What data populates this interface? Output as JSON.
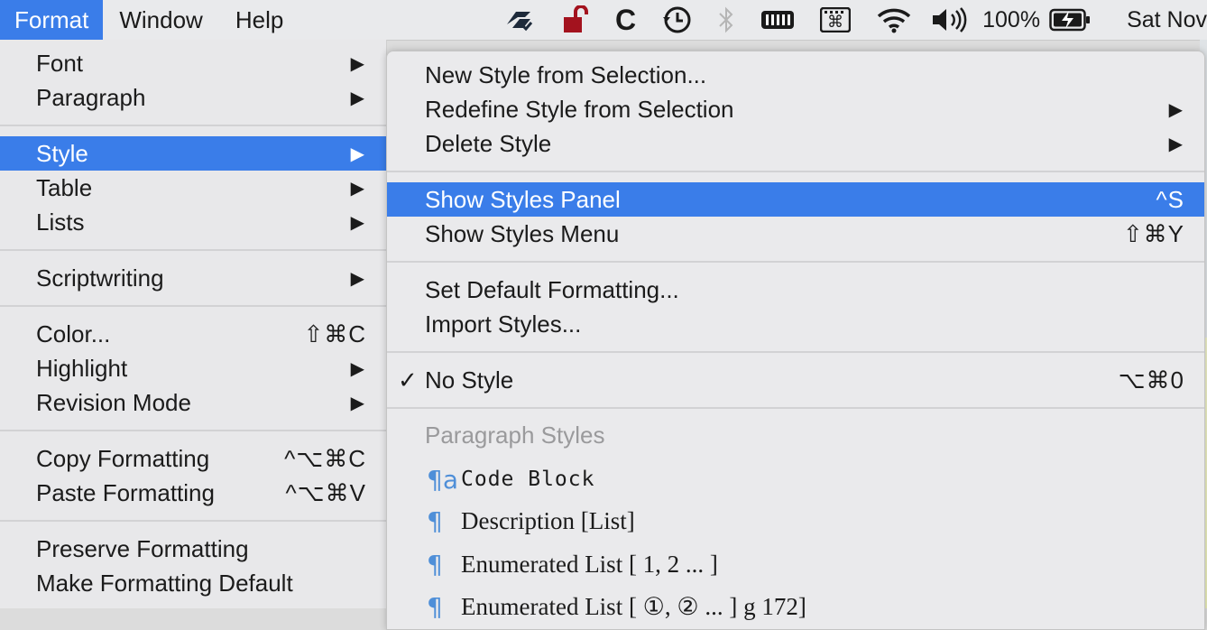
{
  "menubar": {
    "items": [
      {
        "label": "Format",
        "active": true
      },
      {
        "label": "Window",
        "active": false
      },
      {
        "label": "Help",
        "active": false
      }
    ],
    "status": {
      "battery_percent": "100%",
      "datetime": "Sat Nov"
    },
    "icons": [
      "sync-icon",
      "lock-icon",
      "c-app-icon",
      "time-machine-icon",
      "bluetooth-icon",
      "memory-icon",
      "keyboard-command-icon",
      "wifi-icon",
      "volume-icon",
      "battery-icon"
    ]
  },
  "format_menu": {
    "items": [
      {
        "label": "Font",
        "arrow": "▶",
        "shortcut": ""
      },
      {
        "label": "Paragraph",
        "arrow": "▶",
        "shortcut": ""
      },
      {
        "label": "Style",
        "arrow": "▶",
        "shortcut": "",
        "highlighted": true
      },
      {
        "label": "Table",
        "arrow": "▶",
        "shortcut": ""
      },
      {
        "label": "Lists",
        "arrow": "▶",
        "shortcut": ""
      },
      {
        "label": "Scriptwriting",
        "arrow": "▶",
        "shortcut": ""
      },
      {
        "label": "Color...",
        "arrow": "",
        "shortcut": "⇧⌘C"
      },
      {
        "label": "Highlight",
        "arrow": "▶",
        "shortcut": ""
      },
      {
        "label": "Revision Mode",
        "arrow": "▶",
        "shortcut": ""
      },
      {
        "label": "Copy Formatting",
        "arrow": "",
        "shortcut": "^⌥⌘C"
      },
      {
        "label": "Paste Formatting",
        "arrow": "",
        "shortcut": "^⌥⌘V"
      },
      {
        "label": "Preserve Formatting",
        "arrow": "",
        "shortcut": ""
      },
      {
        "label": "Make Formatting Default",
        "arrow": "",
        "shortcut": ""
      }
    ]
  },
  "style_submenu": {
    "items": [
      {
        "label": "New Style from Selection...",
        "arrow": "",
        "shortcut": ""
      },
      {
        "label": "Redefine Style from Selection",
        "arrow": "▶",
        "shortcut": ""
      },
      {
        "label": "Delete Style",
        "arrow": "▶",
        "shortcut": ""
      },
      {
        "label": "Show Styles Panel",
        "arrow": "",
        "shortcut": "^S",
        "highlighted": true
      },
      {
        "label": "Show Styles Menu",
        "arrow": "",
        "shortcut": "⇧⌘Y"
      },
      {
        "label": "Set Default Formatting...",
        "arrow": "",
        "shortcut": ""
      },
      {
        "label": "Import Styles...",
        "arrow": "",
        "shortcut": ""
      },
      {
        "label": "No Style",
        "arrow": "",
        "shortcut": "⌥⌘0",
        "checked": true,
        "check": "✓"
      }
    ],
    "section_label": "Paragraph Styles",
    "paragraph_styles": [
      {
        "marker": "¶a",
        "name": "Code Block"
      },
      {
        "marker": "¶",
        "name": "Description [List]"
      },
      {
        "marker": "¶",
        "name": "Enumerated List [ 1, 2 ... ]"
      },
      {
        "marker": "¶",
        "name": "Enumerated List [ ①, ② ... ] g 172]"
      }
    ]
  }
}
